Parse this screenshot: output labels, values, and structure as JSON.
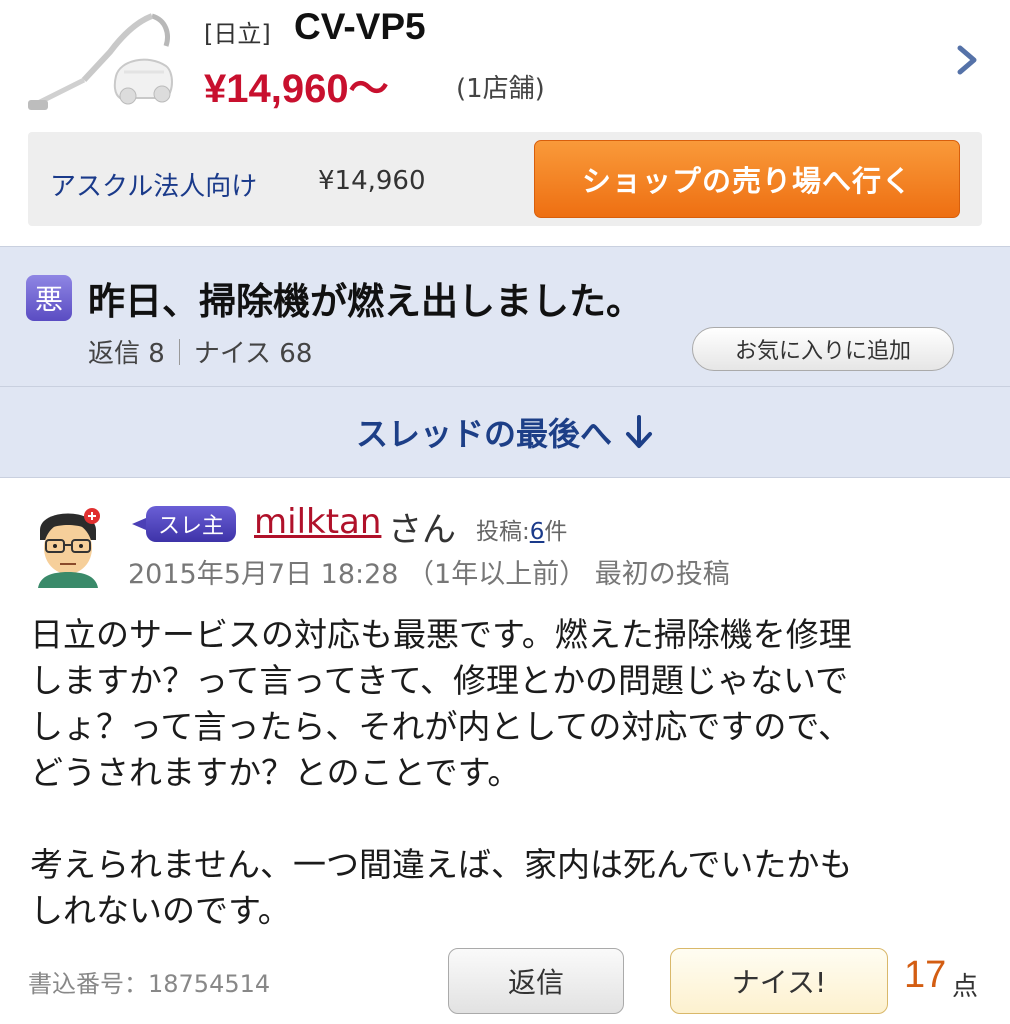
{
  "product": {
    "brand": "[日立]",
    "model": "CV-VP5",
    "price": "¥14,960〜",
    "shop_count": "(1店舗)"
  },
  "shop": {
    "name": "アスクル法人向け",
    "price": "¥14,960",
    "button_label": "ショップの売り場へ行く"
  },
  "thread": {
    "badge": "悪",
    "title": "昨日、掃除機が燃え出しました。",
    "replies": "返信 8",
    "nice": "ナイス 68",
    "favorite_label": "お気に入りに追加",
    "jump_label": "スレッドの最後へ"
  },
  "post": {
    "owner_badge": "スレ主",
    "username": "milktan",
    "honorific": "さん",
    "post_count_prefix": "投稿:",
    "post_count": "6",
    "post_count_suffix": "件",
    "date": "2015年5月7日 18:28 （1年以上前） 最初の投稿",
    "body": "日立のサービスの対応も最悪です。燃えた掃除機を修理\nしますか？って言ってきて、修理とかの問題じゃないで\nしょ？って言ったら、それが内としての対応ですので、\nどうされますか？とのことです。\n\n考えられません、一つ間違えば、家内は死んでいたかも\nしれないのです。",
    "number": "書込番号：18754514",
    "reply_label": "返信",
    "nice_label": "ナイス!",
    "points": "17",
    "points_unit": "点"
  },
  "colors": {
    "price_red": "#c8102e",
    "shop_button_orange": "#ee6f12",
    "band_blue": "#e0e6f3",
    "link_blue": "#1d3f87",
    "username_red": "#b0112a",
    "points_orange": "#d35d12"
  },
  "icons": {
    "chevron": "chevron-right-icon",
    "arrow": "arrow-down-icon",
    "product": "vacuum-cleaner-image",
    "avatar": "user-avatar-icon"
  }
}
